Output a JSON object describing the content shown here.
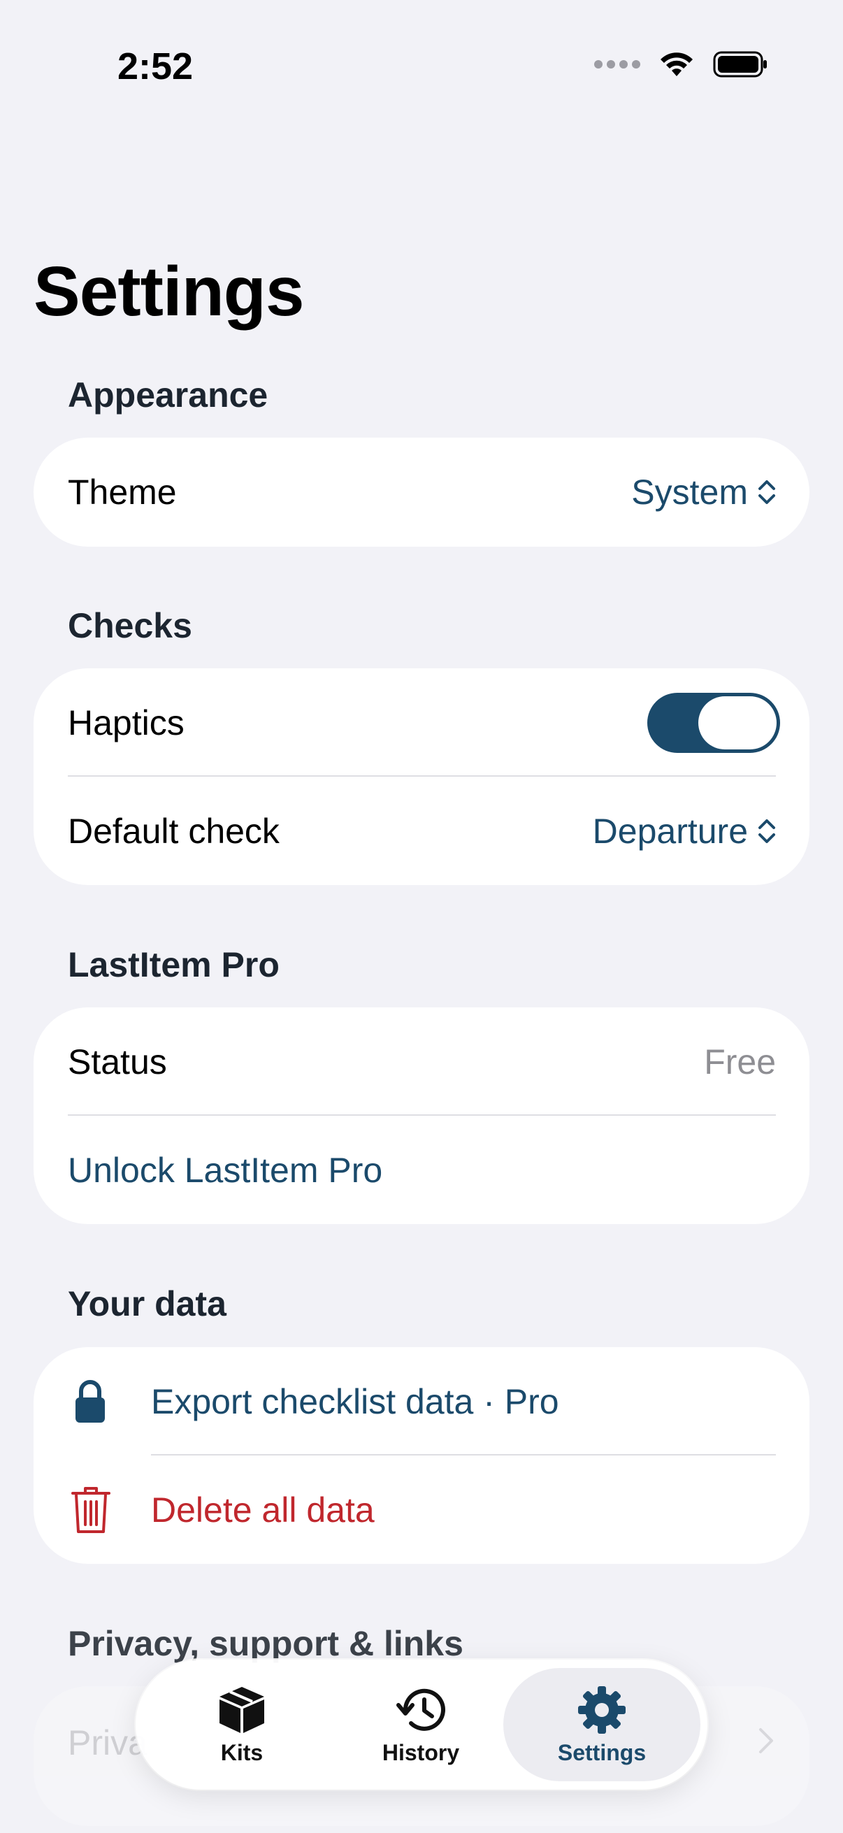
{
  "status_bar": {
    "time": "2:52"
  },
  "page_title": "Settings",
  "sections": {
    "appearance": {
      "header": "Appearance",
      "theme": {
        "label": "Theme",
        "value": "System"
      }
    },
    "checks": {
      "header": "Checks",
      "haptics": {
        "label": "Haptics",
        "enabled": true
      },
      "default_check": {
        "label": "Default check",
        "value": "Departure"
      }
    },
    "pro": {
      "header": "LastItem Pro",
      "status": {
        "label": "Status",
        "value": "Free"
      },
      "unlock_label": "Unlock LastItem Pro"
    },
    "your_data": {
      "header": "Your data",
      "export_label": "Export checklist data · Pro",
      "delete_label": "Delete all data"
    },
    "privacy": {
      "header": "Privacy, support & links",
      "first_row_partial": "Priva"
    }
  },
  "tab_bar": {
    "tabs": [
      {
        "label": "Kits",
        "icon": "box-icon",
        "active": false
      },
      {
        "label": "History",
        "icon": "history-icon",
        "active": false
      },
      {
        "label": "Settings",
        "icon": "gear-icon",
        "active": true
      }
    ]
  },
  "colors": {
    "accent": "#1b4a6b",
    "danger": "#c0272d",
    "background": "#f2f2f7",
    "muted": "#8e8e93"
  }
}
